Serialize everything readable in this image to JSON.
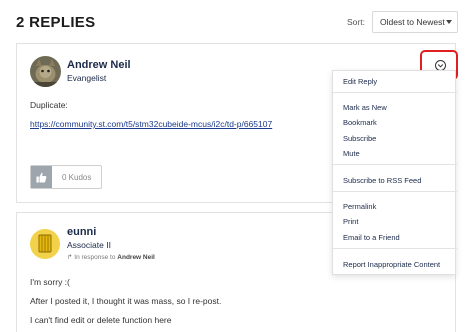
{
  "header": {
    "title": "2 REPLIES",
    "sort_label": "Sort:",
    "sort_value": "Oldest to Newest"
  },
  "post1": {
    "author": "Andrew Neil",
    "role": "Evangelist",
    "body": "Duplicate:",
    "link": "https://community.st.com/t5/stm32cubeide-mcus/i2c/td-p/665107",
    "kudos_label": "0 Kudos"
  },
  "post2": {
    "author": "eunni",
    "role": "Associate II",
    "in_response_prefix": "In response to",
    "in_response_name": "Andrew Neil",
    "lines": [
      "I'm sorry :(",
      "After I posted it, I thought it was mass, so I re-post.",
      "I can't find edit or delete function here"
    ]
  },
  "menu": {
    "edit_reply": "Edit Reply",
    "mark_as_new": "Mark as New",
    "bookmark": "Bookmark",
    "subscribe": "Subscribe",
    "mute": "Mute",
    "subscribe_rss": "Subscribe to RSS Feed",
    "permalink": "Permalink",
    "print": "Print",
    "email_friend": "Email to a Friend",
    "report": "Report Inappropriate Content"
  },
  "icons": {
    "options": "chevron-down-circle-icon",
    "kudos": "thumbs-up-icon",
    "reply_to": "reply-arrow-icon"
  },
  "colors": {
    "highlight": "#e02020",
    "author_text": "#1b2a4a",
    "link": "#1b3a8c"
  }
}
